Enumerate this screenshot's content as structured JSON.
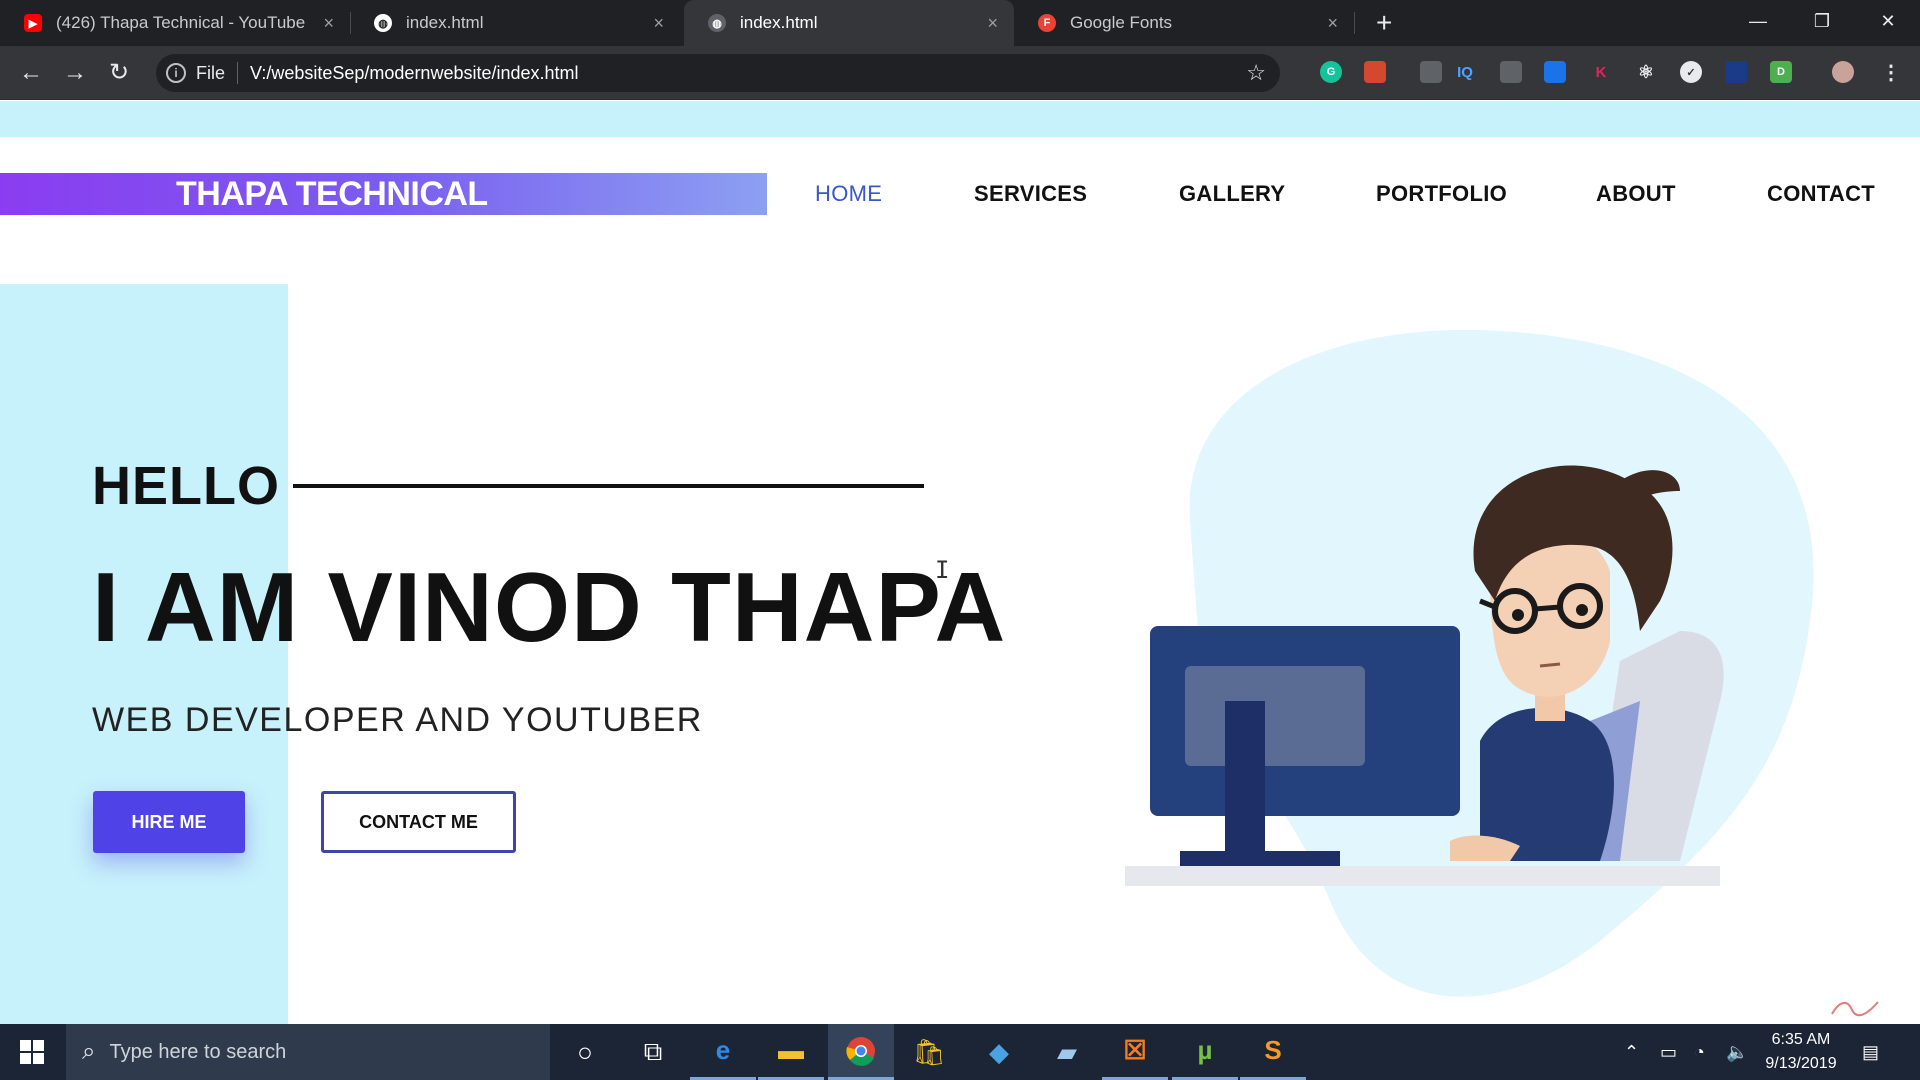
{
  "browser": {
    "tabs": [
      {
        "title": "(426) Thapa Technical - YouTube",
        "icon": "youtube-icon",
        "active": false
      },
      {
        "title": "index.html",
        "icon": "globe-icon",
        "active": false
      },
      {
        "title": "index.html",
        "icon": "globe-icon",
        "active": true
      },
      {
        "title": "Google Fonts",
        "icon": "google-fonts-icon",
        "active": false
      }
    ],
    "new_tab": "+",
    "close": "×",
    "address": {
      "info": "i",
      "scheme_label": "File",
      "url": "V:/websiteSep/modernwebsite/index.html"
    },
    "toolbar_icons": [
      "back-icon",
      "forward-icon",
      "reload-icon",
      "star-icon"
    ]
  },
  "site": {
    "brand": "THAPA TECHNICAL",
    "nav": [
      {
        "label": "HOME",
        "active": true
      },
      {
        "label": "SERVICES",
        "active": false
      },
      {
        "label": "GALLERY",
        "active": false
      },
      {
        "label": "PORTFOLIO",
        "active": false
      },
      {
        "label": "ABOUT",
        "active": false
      },
      {
        "label": "CONTACT",
        "active": false
      }
    ],
    "hero": {
      "hello": "HELLO",
      "name": "I AM VINOD THAPA",
      "role": "WEB DEVELOPER AND YOUTUBER",
      "primary_button": "HIRE ME",
      "secondary_button": "CONTACT ME"
    },
    "colors": {
      "accent": "#4f43e8",
      "light_band": "#c7f1fb",
      "brand_gradient_start": "#8a3df0",
      "brand_gradient_end": "#8ca0f2",
      "nav_active": "#3957c9"
    }
  },
  "taskbar": {
    "search_placeholder": "Type here to search",
    "time": "6:35 AM",
    "date": "9/13/2019",
    "apps": [
      "cortana-icon",
      "task-view-icon",
      "edge-icon",
      "file-explorer-icon",
      "chrome-icon",
      "store-icon",
      "app-icon",
      "notes-icon",
      "xampp-icon",
      "utorrent-icon",
      "sublime-icon"
    ]
  }
}
